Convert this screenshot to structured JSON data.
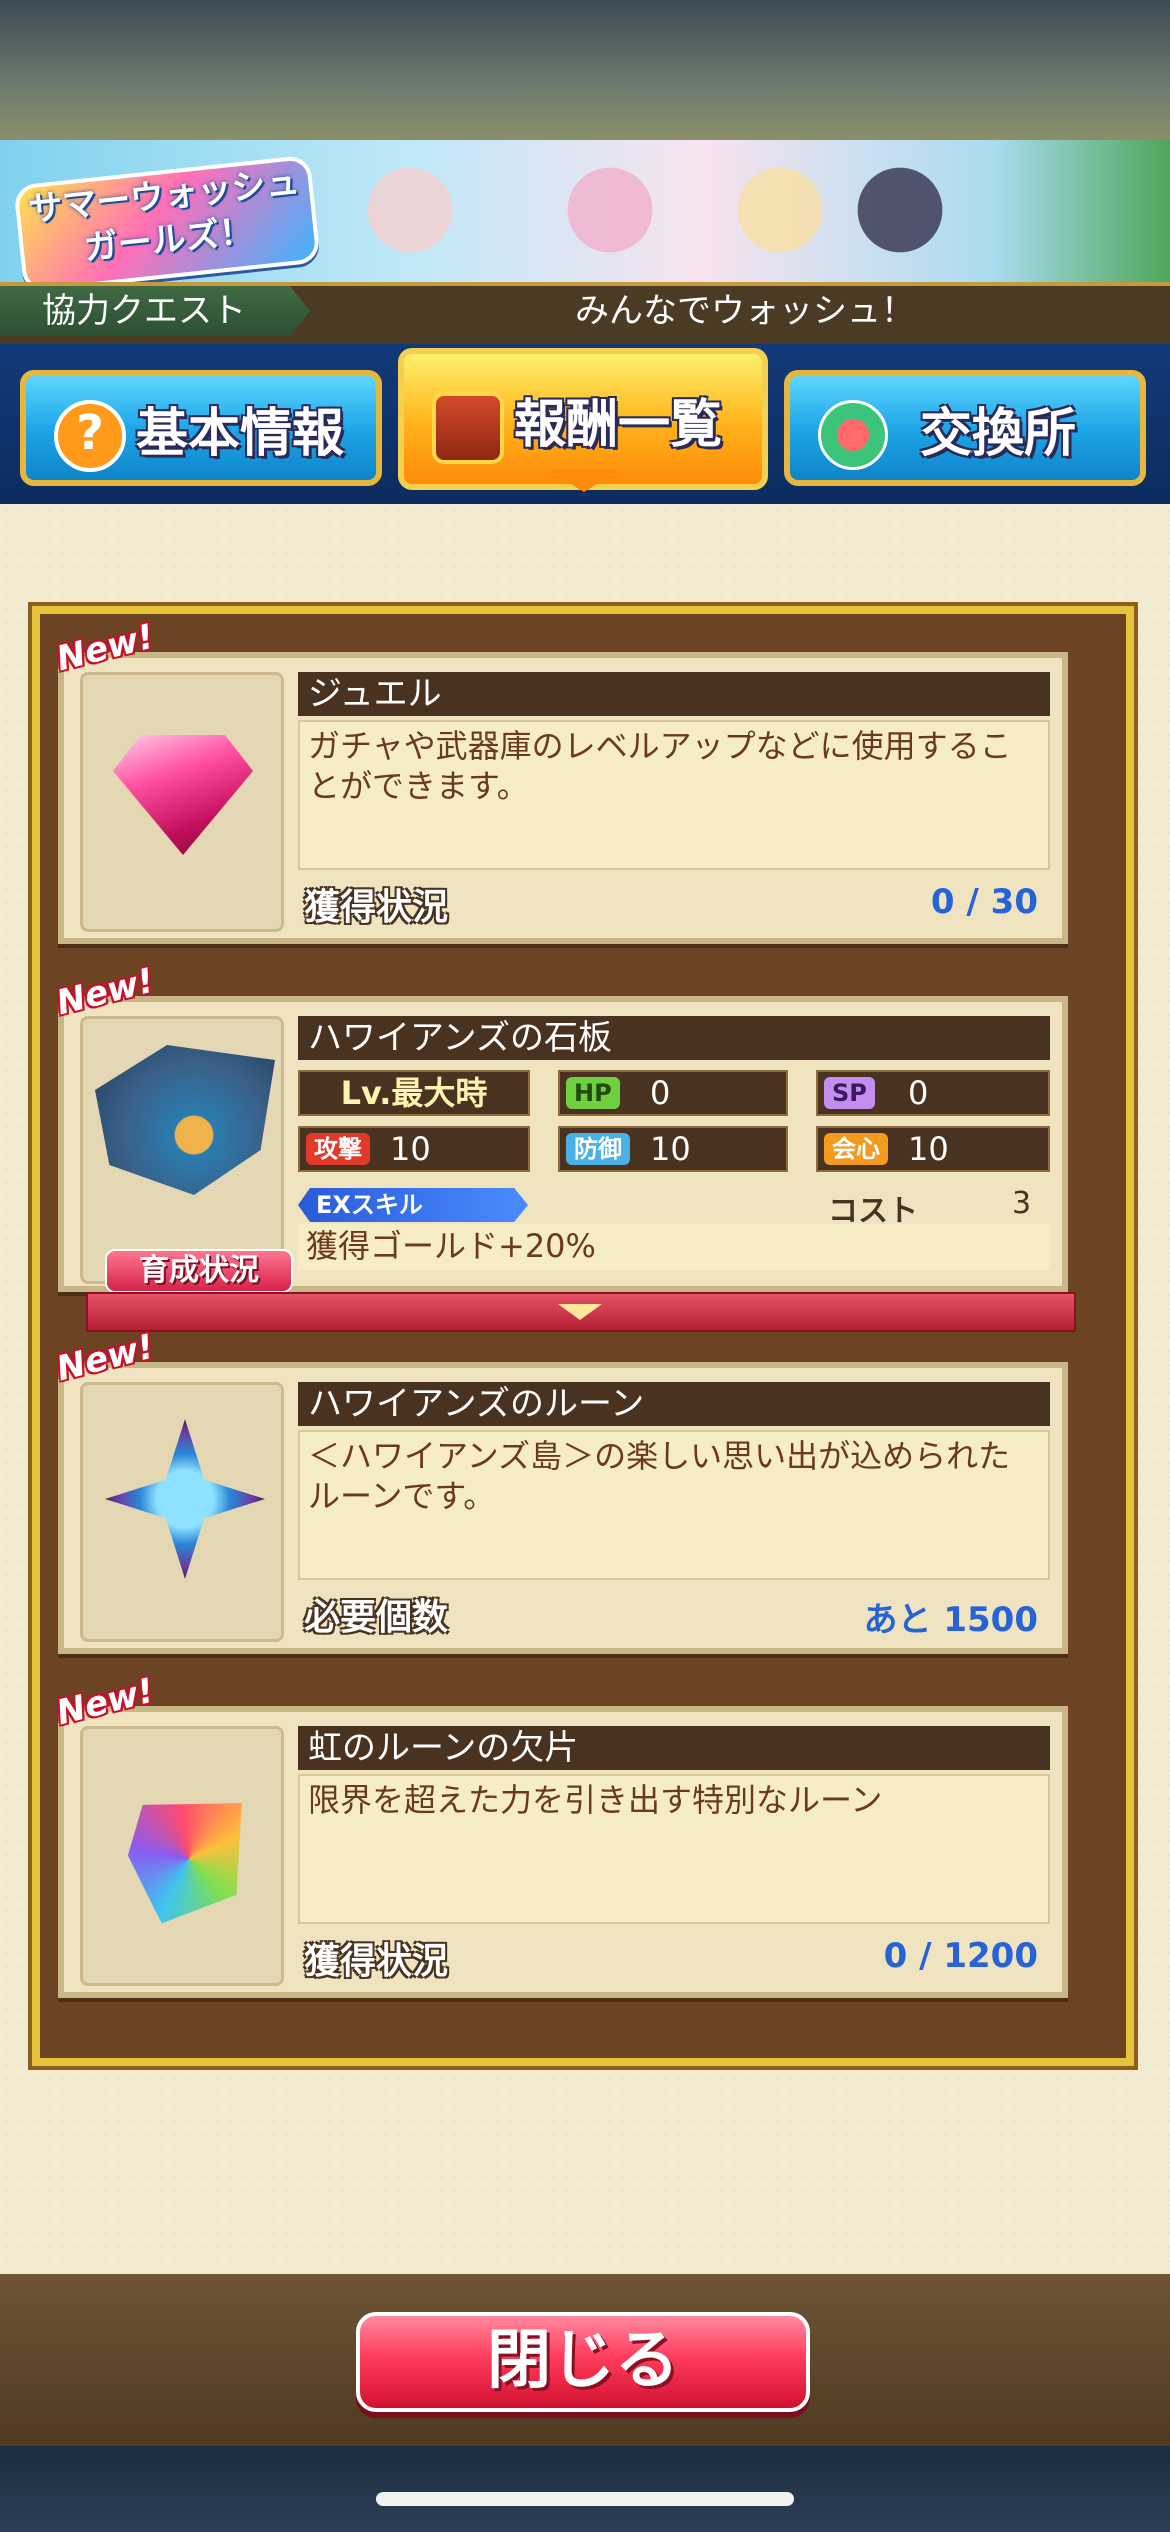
{
  "banner": {
    "logo_line1": "サマーウォッシュ",
    "logo_line2": "ガールズ！"
  },
  "header": {
    "quest_type": "協力クエスト",
    "quest_name": "みんなでウォッシュ！"
  },
  "tabs": [
    {
      "label": "基本情報",
      "icon": "question-icon",
      "active": false
    },
    {
      "label": "報酬一覧",
      "icon": "treasure-chest-icon",
      "active": true
    },
    {
      "label": "交換所",
      "icon": "exchange-icon",
      "active": false
    }
  ],
  "rewards": [
    {
      "badge": "New!",
      "name": "ジュエル",
      "icon": "jewel-icon",
      "description": "ガチャや武器庫のレベルアップなどに使用することができます。",
      "status_label": "獲得状況",
      "status_value": "0 / 30"
    },
    {
      "badge": "New!",
      "name": "ハワイアンズの石板",
      "icon": "stone-tablet-icon",
      "level": "Lv.最大時",
      "stats": {
        "hp_label": "HP",
        "hp": "0",
        "sp_label": "SP",
        "sp": "0",
        "atk_label": "攻撃",
        "atk": "10",
        "def_label": "防御",
        "def": "10",
        "crit_label": "会心",
        "crit": "10"
      },
      "ex_skill_label": "EXスキル",
      "cost_label": "コスト",
      "cost_value": "3",
      "ex_skill_desc": "獲得ゴールド+20%",
      "grow_button": "育成状況"
    },
    {
      "badge": "New!",
      "name": "ハワイアンズのルーン",
      "icon": "rune-icon",
      "description": "＜ハワイアンズ島＞の楽しい思い出が込められたルーンです。",
      "status_label": "必要個数",
      "status_value": "あと 1500"
    },
    {
      "badge": "New!",
      "name": "虹のルーンの欠片",
      "icon": "rainbow-rune-fragment-icon",
      "description": "限界を超えた力を引き出す特別なルーン",
      "status_label": "獲得状況",
      "status_value": "0 / 1200"
    }
  ],
  "footer": {
    "close_label": "閉じる"
  },
  "colors": {
    "accent_gold": "#e6c33a",
    "status_blue": "#2563d6",
    "close_red": "#ff3b5c"
  }
}
